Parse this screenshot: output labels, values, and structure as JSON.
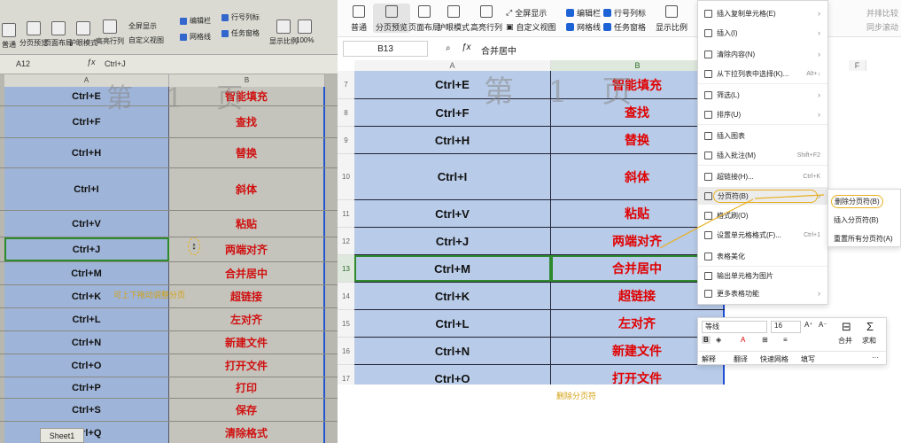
{
  "left_photo": {
    "ribbon": {
      "buttons": [
        "普通",
        "分页预览",
        "页面布局",
        "护眼模式",
        "高亮行列",
        "全屏显示",
        "自定义视图",
        "显示比例",
        "100%"
      ],
      "checks": [
        "编辑栏",
        "行号列标",
        "网格线",
        "任务窗格"
      ]
    },
    "name_box": "A12",
    "formula": "Ctrl+J",
    "col_a": "A",
    "col_b": "B",
    "watermark": "第 1 页",
    "rows": [
      {
        "key": "Ctrl+E",
        "action": "智能填充"
      },
      {
        "key": "Ctrl+F",
        "action": "查找"
      },
      {
        "key": "Ctrl+H",
        "action": "替换"
      },
      {
        "key": "Ctrl+I",
        "action": "斜体"
      },
      {
        "key": "Ctrl+V",
        "action": "粘贴"
      },
      {
        "key": "Ctrl+J",
        "action": "两端对齐"
      },
      {
        "key": "Ctrl+M",
        "action": "合并居中"
      },
      {
        "key": "Ctrl+K",
        "action": "超链接"
      },
      {
        "key": "Ctrl+L",
        "action": "左对齐"
      },
      {
        "key": "Ctrl+N",
        "action": "新建文件"
      },
      {
        "key": "Ctrl+O",
        "action": "打开文件"
      },
      {
        "key": "Ctrl+P",
        "action": "打印"
      },
      {
        "key": "Ctrl+S",
        "action": "保存"
      },
      {
        "key": "Ctrl+Q",
        "action": "清除格式"
      }
    ],
    "annotation": "可上下拖动调整分页",
    "sheet_tab": "Sheet1"
  },
  "right_screen": {
    "ribbon": {
      "buttons": [
        "普通",
        "分页预览",
        "页面布局",
        "护眼模式",
        "高亮行列",
        "自定义视图",
        "显示比例"
      ],
      "fullscreen": "全屏显示",
      "checks": [
        "编辑栏",
        "行号列标",
        "网格线",
        "任务窗格"
      ],
      "right_labels": [
        "并排比较",
        "同步滚动"
      ]
    },
    "name_box": "B13",
    "formula": "合并居中",
    "cols": [
      "A",
      "B",
      "F"
    ],
    "watermark": "第 1 页",
    "rows": [
      {
        "n": "7",
        "key": "Ctrl+E",
        "action": "智能填充"
      },
      {
        "n": "8",
        "key": "Ctrl+F",
        "action": "查找"
      },
      {
        "n": "9",
        "key": "Ctrl+H",
        "action": "替换"
      },
      {
        "n": "10",
        "key": "Ctrl+I",
        "action": "斜体"
      },
      {
        "n": "11",
        "key": "Ctrl+V",
        "action": "粘贴"
      },
      {
        "n": "12",
        "key": "Ctrl+J",
        "action": "两端对齐"
      },
      {
        "n": "13",
        "key": "Ctrl+M",
        "action": "合并居中"
      },
      {
        "n": "14",
        "key": "Ctrl+K",
        "action": "超链接"
      },
      {
        "n": "15",
        "key": "Ctrl+L",
        "action": "左对齐"
      },
      {
        "n": "16",
        "key": "Ctrl+N",
        "action": "新建文件"
      },
      {
        "n": "17",
        "key": "Ctrl+O",
        "action": "打开文件"
      }
    ],
    "annotation": "删除分页符"
  },
  "context_menu": {
    "items": [
      {
        "label": "插入复制单元格(E)",
        "shortcut": "",
        "arrow": true
      },
      {
        "label": "插入(I)",
        "shortcut": "",
        "arrow": true
      },
      {
        "label": "清除内容(N)",
        "shortcut": "",
        "arrow": true
      },
      {
        "label": "从下拉列表中选择(K)...",
        "shortcut": "Alt+↓",
        "arrow": false
      },
      {
        "label": "筛选(L)",
        "shortcut": "",
        "arrow": true
      },
      {
        "label": "排序(U)",
        "shortcut": "",
        "arrow": true
      },
      {
        "label": "插入图表",
        "shortcut": "",
        "arrow": false
      },
      {
        "label": "插入批注(M)",
        "shortcut": "Shift+F2",
        "arrow": false
      },
      {
        "label": "超链接(H)...",
        "shortcut": "Ctrl+K",
        "arrow": false
      },
      {
        "label": "分页符(B)",
        "shortcut": "",
        "arrow": true
      },
      {
        "label": "格式刷(O)",
        "shortcut": "",
        "arrow": false
      },
      {
        "label": "设置单元格格式(F)...",
        "shortcut": "Ctrl+1",
        "arrow": false
      },
      {
        "label": "表格美化",
        "shortcut": "",
        "arrow": false
      },
      {
        "label": "输出单元格为图片",
        "shortcut": "",
        "arrow": false
      },
      {
        "label": "更多表格功能",
        "shortcut": "",
        "arrow": true
      }
    ],
    "submenu": [
      "删除分页符(B)",
      "插入分页符(B)",
      "重置所有分页符(A)"
    ]
  },
  "format_toolbar": {
    "font": "等线",
    "size": "16",
    "merge": "合并",
    "sum": "求和",
    "actions": [
      "解释",
      "翻译",
      "快速网格",
      "填写"
    ]
  },
  "colors": {
    "red_text": "#e00000",
    "cell_blue": "#b8cbe8",
    "accent_yellow": "#e8b020",
    "selection_green": "#2f8a2f"
  }
}
